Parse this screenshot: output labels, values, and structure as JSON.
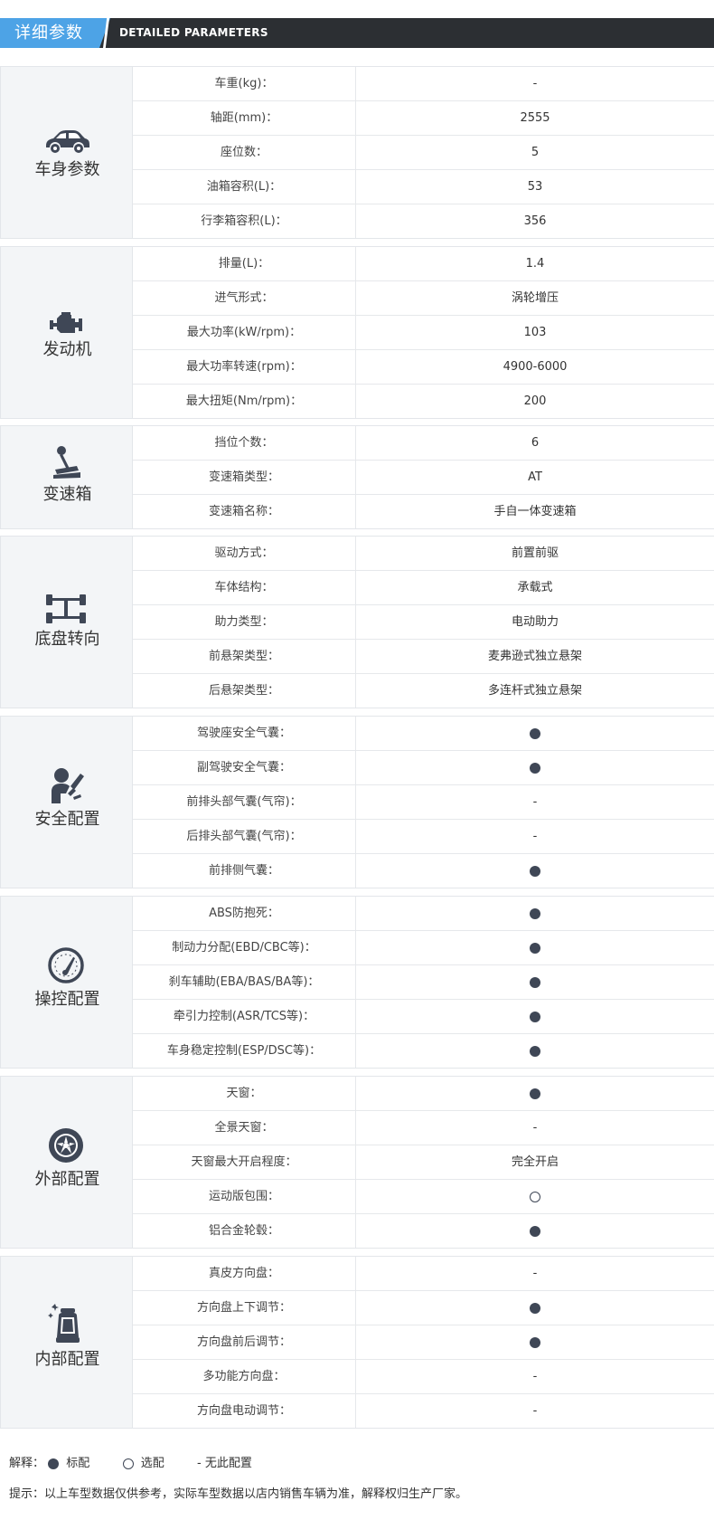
{
  "header": {
    "title": "详细参数",
    "subtitle": "DETAILED PARAMETERS"
  },
  "sections": [
    {
      "category": "车身参数",
      "icon": "car-icon",
      "rows": [
        {
          "label": "车重(kg)：",
          "value": "-"
        },
        {
          "label": "轴距(mm)：",
          "value": "2555"
        },
        {
          "label": "座位数：",
          "value": "5"
        },
        {
          "label": "油箱容积(L)：",
          "value": "53"
        },
        {
          "label": "行李箱容积(L)：",
          "value": "356"
        }
      ]
    },
    {
      "category": "发动机",
      "icon": "engine-icon",
      "rows": [
        {
          "label": "排量(L)：",
          "value": "1.4"
        },
        {
          "label": "进气形式：",
          "value": "涡轮增压"
        },
        {
          "label": "最大功率(kW/rpm)：",
          "value": "103"
        },
        {
          "label": "最大功率转速(rpm)：",
          "value": "4900-6000"
        },
        {
          "label": "最大扭矩(Nm/rpm)：",
          "value": "200"
        }
      ]
    },
    {
      "category": "变速箱",
      "icon": "gear-shift-icon",
      "rows": [
        {
          "label": "挡位个数：",
          "value": "6"
        },
        {
          "label": "变速箱类型：",
          "value": "AT"
        },
        {
          "label": "变速箱名称：",
          "value": "手自一体变速箱"
        }
      ]
    },
    {
      "category": "底盘转向",
      "icon": "chassis-icon",
      "rows": [
        {
          "label": "驱动方式：",
          "value": "前置前驱"
        },
        {
          "label": "车体结构：",
          "value": "承载式"
        },
        {
          "label": "助力类型：",
          "value": "电动助力"
        },
        {
          "label": "前悬架类型：",
          "value": "麦弗逊式独立悬架"
        },
        {
          "label": "后悬架类型：",
          "value": "多连杆式独立悬架"
        }
      ]
    },
    {
      "category": "安全配置",
      "icon": "airbag-icon",
      "rows": [
        {
          "label": "驾驶座安全气囊：",
          "mark": "standard"
        },
        {
          "label": "副驾驶安全气囊：",
          "mark": "standard"
        },
        {
          "label": "前排头部气囊(气帘)：",
          "value": "-"
        },
        {
          "label": "后排头部气囊(气帘)：",
          "value": "-"
        },
        {
          "label": "前排侧气囊：",
          "mark": "standard"
        }
      ]
    },
    {
      "category": "操控配置",
      "icon": "gauge-icon",
      "rows": [
        {
          "label": "ABS防抱死：",
          "mark": "standard"
        },
        {
          "label": "制动力分配(EBD/CBC等)：",
          "mark": "standard"
        },
        {
          "label": "刹车辅助(EBA/BAS/BA等)：",
          "mark": "standard"
        },
        {
          "label": "牵引力控制(ASR/TCS等)：",
          "mark": "standard"
        },
        {
          "label": "车身稳定控制(ESP/DSC等)：",
          "mark": "standard"
        }
      ]
    },
    {
      "category": "外部配置",
      "icon": "wheel-icon",
      "rows": [
        {
          "label": "天窗：",
          "mark": "standard"
        },
        {
          "label": "全景天窗：",
          "value": "-"
        },
        {
          "label": "天窗最大开启程度：",
          "value": "完全开启"
        },
        {
          "label": "运动版包围：",
          "mark": "optional"
        },
        {
          "label": "铝合金轮毂：",
          "mark": "standard"
        }
      ]
    },
    {
      "category": "内部配置",
      "icon": "seat-icon",
      "rows": [
        {
          "label": "真皮方向盘：",
          "value": "-"
        },
        {
          "label": "方向盘上下调节：",
          "mark": "standard"
        },
        {
          "label": "方向盘前后调节：",
          "mark": "standard"
        },
        {
          "label": "多功能方向盘：",
          "value": "-"
        },
        {
          "label": "方向盘电动调节：",
          "value": "-"
        }
      ]
    }
  ],
  "legend": {
    "prefix": "解释：",
    "standard": "标配",
    "optional": "选配",
    "none": "- 无此配置"
  },
  "note": "提示：以上车型数据仅供参考，实际车型数据以店内销售车辆为准，解释权归生产厂家。",
  "colors": {
    "accent": "#4da3e6",
    "header_bg": "#2c2f33",
    "icon": "#3f4756"
  }
}
